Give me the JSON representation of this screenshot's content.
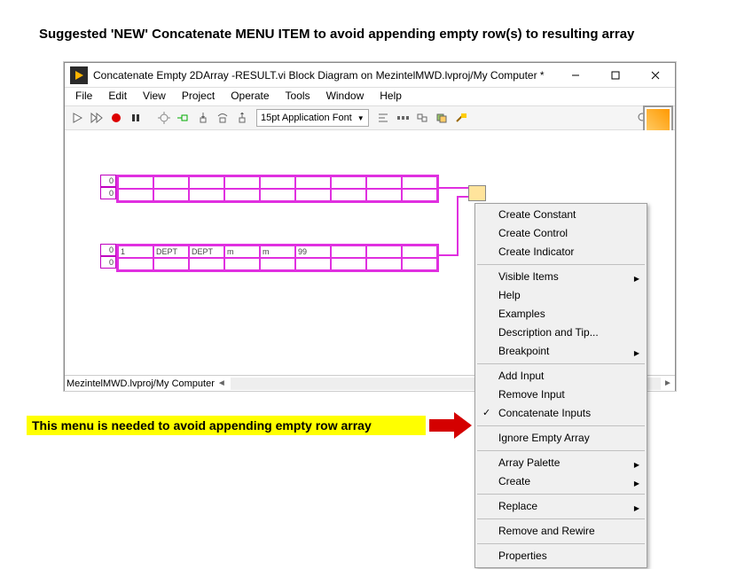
{
  "page_heading": "Suggested 'NEW' Concatenate MENU ITEM to avoid appending empty row(s) to resulting array",
  "window": {
    "title": "Concatenate Empty 2DArray -RESULT.vi Block Diagram on MezintelMWD.lvproj/My Computer *"
  },
  "menubar": {
    "file": "File",
    "edit": "Edit",
    "view": "View",
    "project": "Project",
    "operate": "Operate",
    "tools": "Tools",
    "window": "Window",
    "help": "Help"
  },
  "toolbar": {
    "font": "15pt Application Font"
  },
  "array1": {
    "idx": [
      "0",
      "0"
    ],
    "rows": [
      [
        "",
        "",
        "",
        "",
        "",
        "",
        "",
        "",
        ""
      ],
      [
        "",
        "",
        "",
        "",
        "",
        "",
        "",
        "",
        ""
      ]
    ]
  },
  "array2": {
    "idx": [
      "0",
      "0"
    ],
    "rows": [
      [
        "1",
        "DEPT",
        "DEPT",
        "m",
        "m",
        "99",
        "",
        "",
        ""
      ],
      [
        "",
        "",
        "",
        "",
        "",
        "",
        "",
        "",
        ""
      ]
    ]
  },
  "statusbar": {
    "text": "MezintelMWD.lvproj/My Computer"
  },
  "context_menu": {
    "items": [
      {
        "label": "Create Constant"
      },
      {
        "label": "Create Control"
      },
      {
        "label": "Create Indicator"
      },
      {
        "sep": true
      },
      {
        "label": "Visible Items",
        "sub": true
      },
      {
        "label": "Help"
      },
      {
        "label": "Examples"
      },
      {
        "label": "Description and Tip..."
      },
      {
        "label": "Breakpoint",
        "sub": true
      },
      {
        "sep": true
      },
      {
        "label": "Add Input"
      },
      {
        "label": "Remove Input"
      },
      {
        "label": "Concatenate Inputs",
        "check": true
      },
      {
        "sep": true
      },
      {
        "label": "Ignore Empty Array"
      },
      {
        "sep": true
      },
      {
        "label": "Array Palette",
        "sub": true
      },
      {
        "label": "Create",
        "sub": true
      },
      {
        "sep": true
      },
      {
        "label": "Replace",
        "sub": true
      },
      {
        "sep": true
      },
      {
        "label": "Remove and Rewire"
      },
      {
        "sep": true
      },
      {
        "label": "Properties"
      }
    ]
  },
  "highlight_text": "This menu is needed to avoid appending empty row array"
}
